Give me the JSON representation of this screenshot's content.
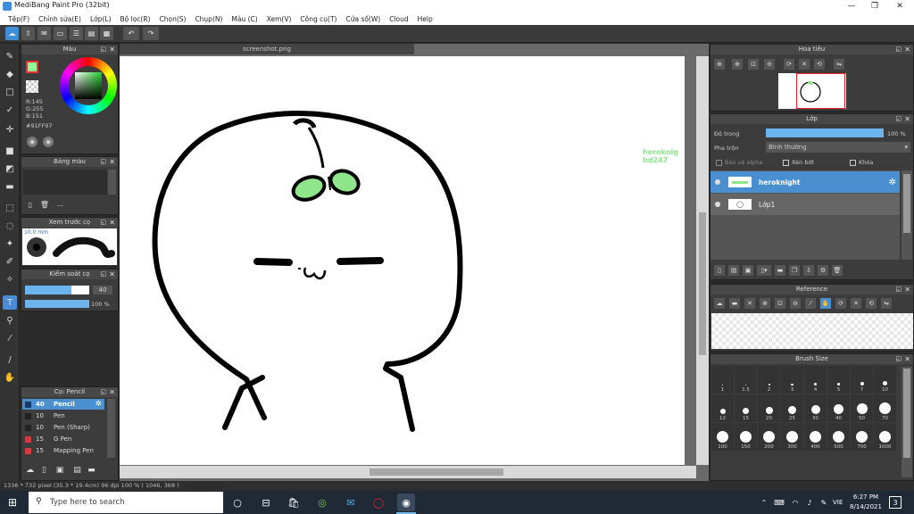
{
  "window": {
    "title": "MediBang Paint Pro (32bit)"
  },
  "menu": [
    "Tệp(F)",
    "Chỉnh sửa(E)",
    "Lớp(L)",
    "Bộ lọc(R)",
    "Chọn(S)",
    "Chụp(N)",
    "Màu (C)",
    "Xem(V)",
    "Công cụ(T)",
    "Cửa sổ(W)",
    "Cloud",
    "Help"
  ],
  "canvas": {
    "tab": "screenshot.png",
    "watermark1": "heroknig",
    "watermark2": "bd247"
  },
  "color_panel": {
    "title": "Màu",
    "r": "R:145",
    "g": "G:255",
    "b": "B:151",
    "hex": "#91FF97"
  },
  "palette_panel": {
    "title": "Bảng màu",
    "dash": "---"
  },
  "preview_panel": {
    "title": "Xem trước cọ",
    "size": "10.0 mm"
  },
  "brush_control": {
    "title": "Kiểm soát cọ",
    "size": "40",
    "opacity": "100 %",
    "size_fill": 0.72,
    "opacity_fill": 1.0
  },
  "brushes": {
    "title": "Cọ: Pencil",
    "items": [
      {
        "size": "40",
        "name": "Pencil",
        "color": "#1a3a6a",
        "selected": true
      },
      {
        "size": "10",
        "name": "Pen",
        "color": "#222222",
        "selected": false
      },
      {
        "size": "10",
        "name": "Pen (Sharp)",
        "color": "#222222",
        "selected": false
      },
      {
        "size": "15",
        "name": "G Pen",
        "color": "#d23c3c",
        "selected": false
      },
      {
        "size": "15",
        "name": "Mapping Pen",
        "color": "#d23c3c",
        "selected": false
      }
    ]
  },
  "navigator": {
    "title": "Hoa tiêu"
  },
  "layer_panel": {
    "title": "Lớp",
    "opacity_label": "Độ trong",
    "opacity_value": "100 %",
    "blend_label": "Pha trộn",
    "blend_value": "Bình thường",
    "protect_alpha": "Bảo vệ alpha",
    "clipping": "Xén bớt",
    "lock": "Khóa",
    "opacity_fill": 1.0,
    "layers": [
      {
        "name": "heroknight",
        "selected": true
      },
      {
        "name": "Lớp1",
        "selected": false
      }
    ]
  },
  "reference": {
    "title": "Reference"
  },
  "brush_size": {
    "title": "Brush Size",
    "sizes": [
      "1",
      "1.5",
      "2",
      "3",
      "4",
      "5",
      "7",
      "10",
      "12",
      "15",
      "20",
      "25",
      "30",
      "40",
      "50",
      "70",
      "100",
      "150",
      "200",
      "300",
      "400",
      "500",
      "700",
      "1000"
    ]
  },
  "status": {
    "text": "1336 * 732 pixel   (35.3 * 19.4cm)  96 dpi  100 %   ( 1046, 368 )"
  },
  "taskbar": {
    "search_placeholder": "Type here to search",
    "lang": "VIE",
    "time": "6:27 PM",
    "date": "8/14/2021",
    "notif": "3"
  }
}
